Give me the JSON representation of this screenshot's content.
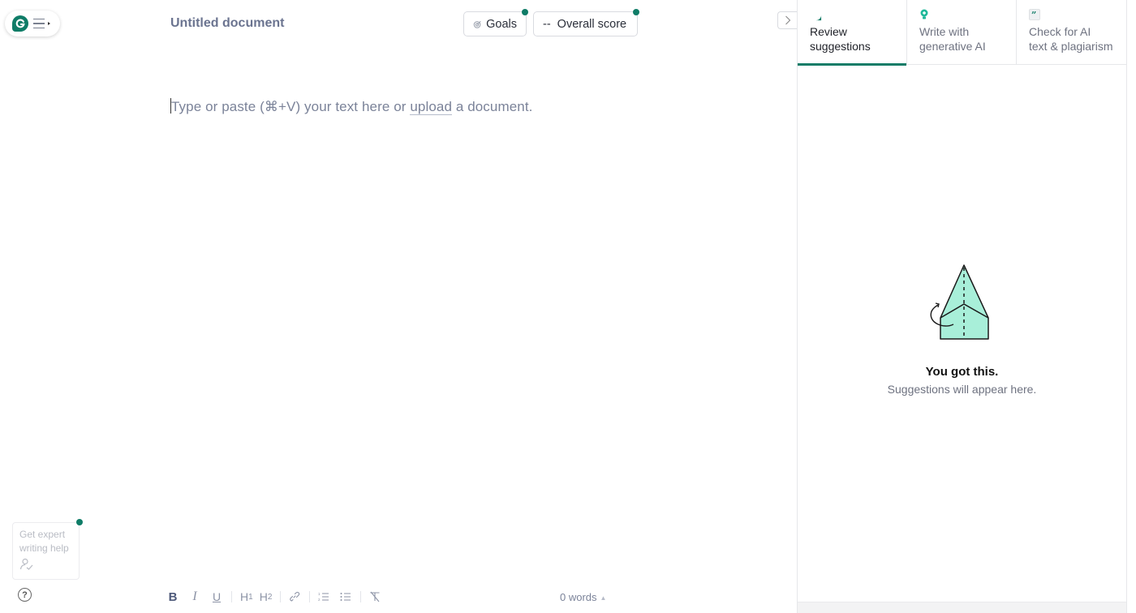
{
  "header": {
    "doc_title": "Untitled document",
    "goals_label": "Goals",
    "score_prefix": "--",
    "score_label": "Overall score",
    "accent_color": "#0f7c67"
  },
  "editor": {
    "placeholder_before": "Type or paste (⌘+V) your text here or ",
    "placeholder_link": "upload",
    "placeholder_after": " a document."
  },
  "sidebar_left": {
    "expert_help_label": "Get expert writing help",
    "help_icon": "question-circle-icon"
  },
  "toolbar": {
    "bold": "B",
    "italic": "I",
    "underline": "U",
    "h1": "H",
    "h1_sub": "1",
    "h2": "H",
    "h2_sub": "2",
    "word_count": "0 words",
    "word_count_arrow": "▲"
  },
  "right_panel": {
    "tabs": [
      {
        "label_line1": "Review",
        "label_line2": "suggestions",
        "icon": "grammarly-g-icon",
        "active": true
      },
      {
        "label_line1": "Write with",
        "label_line2": "generative AI",
        "icon": "lightbulb-icon",
        "active": false
      },
      {
        "label_line1": "Check for AI",
        "label_line2": "text & plagiarism",
        "icon": "quote-icon",
        "active": false
      }
    ],
    "empty_title": "You got this.",
    "empty_subtitle": "Suggestions will appear here."
  }
}
